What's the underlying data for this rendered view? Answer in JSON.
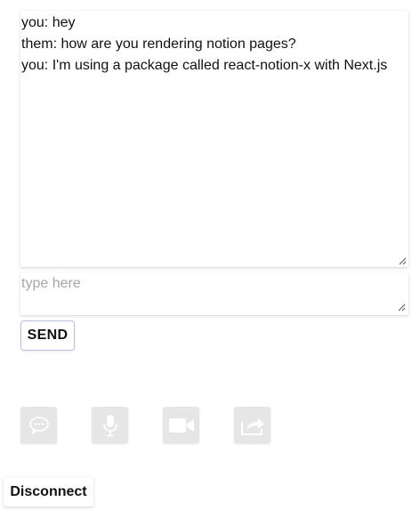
{
  "chat": {
    "messages": [
      {
        "text": "you: hey"
      },
      {
        "text": "them: how are you rendering notion pages?"
      },
      {
        "text": "you: I'm using a package called react-notion-x with Next.js"
      }
    ]
  },
  "composer": {
    "placeholder": "type here",
    "value": "",
    "send_label": "SEND"
  },
  "controls": [
    {
      "icon": "chat-bubble-icon",
      "enabled": false
    },
    {
      "icon": "microphone-icon",
      "enabled": false
    },
    {
      "icon": "video-camera-icon",
      "enabled": false
    },
    {
      "icon": "share-icon",
      "enabled": false
    }
  ],
  "disconnect": {
    "label": "Disconnect"
  },
  "colors": {
    "control_bg": "#e6e6e6",
    "control_icon": "#ffffff",
    "send_border": "#b9c0e6",
    "placeholder": "#a6a6a6"
  }
}
